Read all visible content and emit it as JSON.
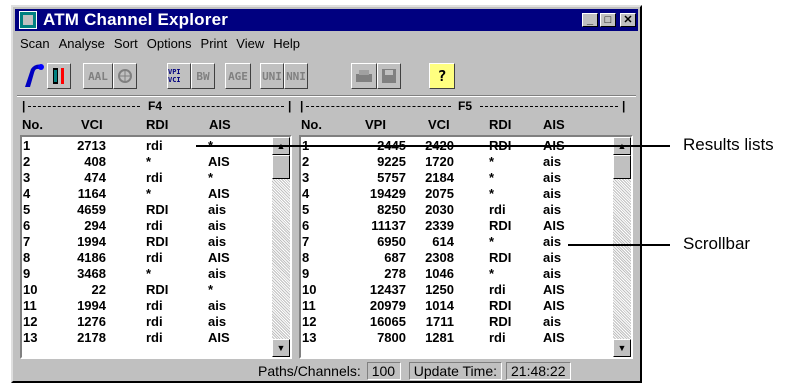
{
  "window": {
    "title": "ATM Channel Explorer"
  },
  "menu": [
    "Scan",
    "Analyse",
    "Sort",
    "Options",
    "Print",
    "View",
    "Help"
  ],
  "toolbar": {
    "buttons": [
      {
        "label": "",
        "icon": "channel-scan-icon"
      },
      {
        "label": "",
        "icon": "meter-icon"
      },
      {
        "label": "AAL",
        "icon": ""
      },
      {
        "label": "",
        "icon": "globe-icon"
      },
      {
        "label": "VPI VCI",
        "icon": ""
      },
      {
        "label": "BW",
        "icon": ""
      },
      {
        "label": "AGE",
        "icon": ""
      },
      {
        "label": "UNI",
        "icon": ""
      },
      {
        "label": "NNI",
        "icon": ""
      },
      {
        "label": "",
        "icon": "print-icon"
      },
      {
        "label": "",
        "icon": "save-icon"
      },
      {
        "label": "?",
        "icon": "help-icon"
      }
    ]
  },
  "f4": {
    "header": "F4",
    "columns": [
      "No.",
      "VCI",
      "RDI",
      "AIS"
    ],
    "rows": [
      [
        "1",
        "2713",
        "rdi",
        "*"
      ],
      [
        "2",
        "408",
        "*",
        "AIS"
      ],
      [
        "3",
        "474",
        "rdi",
        "*"
      ],
      [
        "4",
        "1164",
        "*",
        "AIS"
      ],
      [
        "5",
        "4659",
        "RDI",
        "ais"
      ],
      [
        "6",
        "294",
        "rdi",
        "ais"
      ],
      [
        "7",
        "1994",
        "RDI",
        "ais"
      ],
      [
        "8",
        "4186",
        "rdi",
        "AIS"
      ],
      [
        "9",
        "3468",
        "*",
        "ais"
      ],
      [
        "10",
        "22",
        "RDI",
        "*"
      ],
      [
        "11",
        "1994",
        "rdi",
        "ais"
      ],
      [
        "12",
        "1276",
        "rdi",
        "ais"
      ],
      [
        "13",
        "2178",
        "rdi",
        "AIS"
      ]
    ]
  },
  "f5": {
    "header": "F5",
    "columns": [
      "No.",
      "VPI",
      "VCI",
      "RDI",
      "AIS"
    ],
    "rows": [
      [
        "1",
        "2445",
        "2420",
        "RDI",
        "AIS"
      ],
      [
        "2",
        "9225",
        "1720",
        "*",
        "ais"
      ],
      [
        "3",
        "5757",
        "2184",
        "*",
        "ais"
      ],
      [
        "4",
        "19429",
        "2075",
        "*",
        "ais"
      ],
      [
        "5",
        "8250",
        "2030",
        "rdi",
        "ais"
      ],
      [
        "6",
        "11137",
        "2339",
        "RDI",
        "AIS"
      ],
      [
        "7",
        "6950",
        "614",
        "*",
        "ais"
      ],
      [
        "8",
        "687",
        "2308",
        "RDI",
        "ais"
      ],
      [
        "9",
        "278",
        "1046",
        "*",
        "ais"
      ],
      [
        "10",
        "12437",
        "1250",
        "rdi",
        "AIS"
      ],
      [
        "11",
        "20979",
        "1014",
        "RDI",
        "AIS"
      ],
      [
        "12",
        "16065",
        "1711",
        "RDI",
        "ais"
      ],
      [
        "13",
        "7800",
        "1281",
        "rdi",
        "AIS"
      ]
    ]
  },
  "status": {
    "paths_label": "Paths/Channels:",
    "paths_value": "100",
    "time_label": "Update Time:",
    "time_value": "21:48:22"
  },
  "callouts": {
    "results": "Results lists",
    "scrollbar": "Scrollbar"
  }
}
